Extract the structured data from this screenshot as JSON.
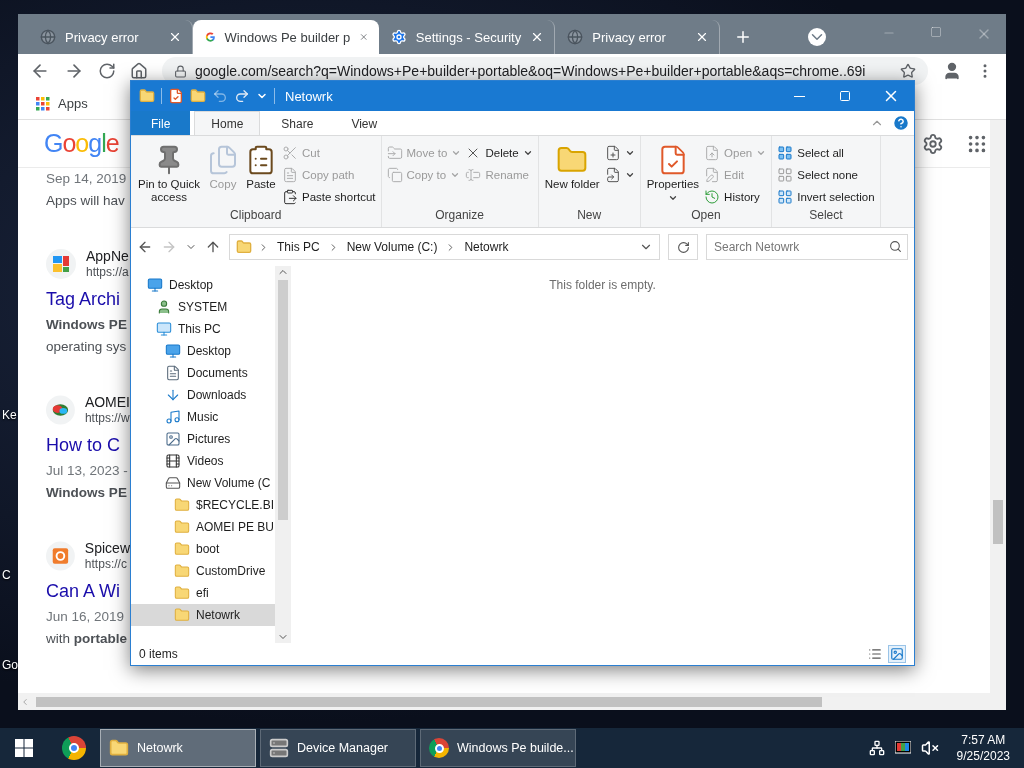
{
  "desktop_icons": [
    {
      "label": "Ke"
    },
    {
      "label": "C"
    },
    {
      "label": "Go"
    }
  ],
  "browser": {
    "tabs": [
      {
        "kind": "error",
        "title": "Privacy error",
        "selected": false
      },
      {
        "kind": "google",
        "title": "Windows Pe builder p",
        "selected": true
      },
      {
        "kind": "settings",
        "title": "Settings - Security",
        "selected": false
      },
      {
        "kind": "error",
        "title": "Privacy error",
        "selected": false
      }
    ],
    "address": "google.com/search?q=Windows+Pe+builder+portable&oq=Windows+Pe+builder+portable&aqs=chrome..69i",
    "bookmarks": [
      "Apps"
    ],
    "page": {
      "logo": "Google",
      "top_lines": [
        {
          "kind": "date",
          "text": "Sep 14, 2019"
        },
        {
          "kind": "snippet",
          "text": "Apps will hav"
        }
      ],
      "results": [
        {
          "kind": "tiles",
          "site": "AppNe",
          "url": "https://a",
          "title": "Tag Archi",
          "lines": [
            {
              "kind": "bold",
              "text": "Windows PE"
            },
            {
              "kind": "snippet",
              "text": "operating sys"
            }
          ]
        },
        {
          "kind": "blob",
          "site": "AOMEI",
          "url": "https://w",
          "title": "How to C",
          "lines": [
            {
              "kind": "date",
              "text": "Jul 13, 2023 -"
            },
            {
              "kind": "bold",
              "text": "Windows PE"
            }
          ]
        },
        {
          "kind": "orange",
          "site": "Spicew",
          "url": "https://c",
          "title": "Can A Wi",
          "lines": [
            {
              "kind": "date",
              "text": "Jun 16, 2019"
            },
            {
              "kind": "snippet",
              "text": "with **portable**"
            }
          ]
        }
      ]
    }
  },
  "explorer": {
    "title": "Netowrk",
    "ribbon_tabs": [
      {
        "kind": "file",
        "label": "File",
        "selected": false
      },
      {
        "kind": "tab",
        "label": "Home",
        "selected": true
      },
      {
        "kind": "tab",
        "label": "Share",
        "selected": false
      },
      {
        "kind": "tab",
        "label": "View",
        "selected": false
      }
    ],
    "ribbon_groups": [
      {
        "label": "Clipboard",
        "columns": [
          [
            {
              "kind": "pin",
              "label": "Pin to Quick access",
              "large": true,
              "disabled": false,
              "dropdown": false
            }
          ],
          [
            {
              "kind": "copy",
              "label": "Copy",
              "large": true,
              "disabled": true,
              "dropdown": false
            }
          ],
          [
            {
              "kind": "paste",
              "label": "Paste",
              "large": true,
              "disabled": false,
              "dropdown": false
            }
          ],
          [
            {
              "kind": "cut",
              "label": "Cut",
              "large": false,
              "disabled": true,
              "dropdown": false
            },
            {
              "kind": "copy_path",
              "label": "Copy path",
              "large": false,
              "disabled": true,
              "dropdown": false
            },
            {
              "kind": "paste_shortcut",
              "label": "Paste shortcut",
              "large": false,
              "disabled": false,
              "dropdown": false
            }
          ]
        ]
      },
      {
        "label": "Organize",
        "columns": [
          [
            {
              "kind": "move_to",
              "label": "Move to",
              "large": false,
              "disabled": true,
              "dropdown": true
            },
            {
              "kind": "copy_to",
              "label": "Copy to",
              "large": false,
              "disabled": true,
              "dropdown": true
            }
          ],
          [
            {
              "kind": "delete",
              "label": "Delete",
              "large": false,
              "disabled": false,
              "dropdown": true
            },
            {
              "kind": "rename",
              "label": "Rename",
              "large": false,
              "disabled": true,
              "dropdown": false
            }
          ]
        ]
      },
      {
        "label": "New",
        "columns": [
          [
            {
              "kind": "new_folder",
              "label": "New folder",
              "large": true,
              "disabled": false,
              "dropdown": false
            }
          ],
          [
            {
              "kind": "new_item",
              "large": false,
              "disabled": false,
              "dropdown": true
            },
            {
              "kind": "easy_access",
              "large": false,
              "disabled": false,
              "dropdown": true
            }
          ]
        ]
      },
      {
        "label": "Open",
        "columns": [
          [
            {
              "kind": "properties",
              "label": "Properties",
              "large": true,
              "disabled": false,
              "dropdown": true
            }
          ],
          [
            {
              "kind": "open",
              "label": "Open",
              "large": false,
              "disabled": true,
              "dropdown": true
            },
            {
              "kind": "edit",
              "label": "Edit",
              "large": false,
              "disabled": true,
              "dropdown": false
            },
            {
              "kind": "history",
              "label": "History",
              "large": false,
              "disabled": false,
              "dropdown": false
            }
          ]
        ]
      },
      {
        "label": "Select",
        "columns": [
          [
            {
              "kind": "select_all",
              "label": "Select all",
              "large": false,
              "disabled": false,
              "dropdown": false
            },
            {
              "kind": "select_none",
              "label": "Select none",
              "large": false,
              "disabled": false,
              "dropdown": false
            },
            {
              "kind": "invert",
              "label": "Invert selection",
              "large": false,
              "disabled": false,
              "dropdown": false
            }
          ]
        ]
      }
    ],
    "nav": {
      "back_disabled": false,
      "forward_disabled": true
    },
    "breadcrumb": [
      "This PC",
      "New Volume (C:)",
      "Netowrk"
    ],
    "search": {
      "placeholder": "Search Netowrk"
    },
    "tree": [
      {
        "kind": "desktop",
        "label": "Desktop",
        "selected": false,
        "children": [
          {
            "kind": "user",
            "label": "SYSTEM",
            "selected": false
          },
          {
            "kind": "pc",
            "label": "This PC",
            "selected": false,
            "children": [
              {
                "kind": "desktop",
                "label": "Desktop",
                "selected": false
              },
              {
                "kind": "documents",
                "label": "Documents",
                "selected": false
              },
              {
                "kind": "downloads",
                "label": "Downloads",
                "selected": false
              },
              {
                "kind": "music",
                "label": "Music",
                "selected": false
              },
              {
                "kind": "pictures",
                "label": "Pictures",
                "selected": false
              },
              {
                "kind": "videos",
                "label": "Videos",
                "selected": false
              },
              {
                "kind": "drive",
                "label": "New Volume (C",
                "selected": false,
                "children": [
                  {
                    "kind": "folder",
                    "label": "$RECYCLE.BI",
                    "selected": false
                  },
                  {
                    "kind": "folder",
                    "label": "AOMEI PE BU",
                    "selected": false
                  },
                  {
                    "kind": "folder",
                    "label": "boot",
                    "selected": false
                  },
                  {
                    "kind": "folder",
                    "label": "CustomDrive",
                    "selected": false
                  },
                  {
                    "kind": "folder",
                    "label": "efi",
                    "selected": false
                  },
                  {
                    "kind": "folder",
                    "label": "Netowrk",
                    "selected": true
                  }
                ]
              }
            ]
          }
        ]
      }
    ],
    "empty_message": "This folder is empty.",
    "status": "0 items",
    "views": [
      {
        "kind": "details",
        "selected": false
      },
      {
        "kind": "large_icons",
        "selected": true
      }
    ]
  },
  "taskbar": {
    "windows": [
      {
        "kind": "folder",
        "label": "Netowrk",
        "selected": true
      },
      {
        "kind": "device_manager",
        "label": "Device Manager",
        "selected": false
      },
      {
        "kind": "chrome",
        "label": "Windows Pe builde...",
        "selected": false
      }
    ],
    "tray": {
      "muted": true,
      "time": "7:57 AM",
      "date": "9/25/2023"
    }
  }
}
